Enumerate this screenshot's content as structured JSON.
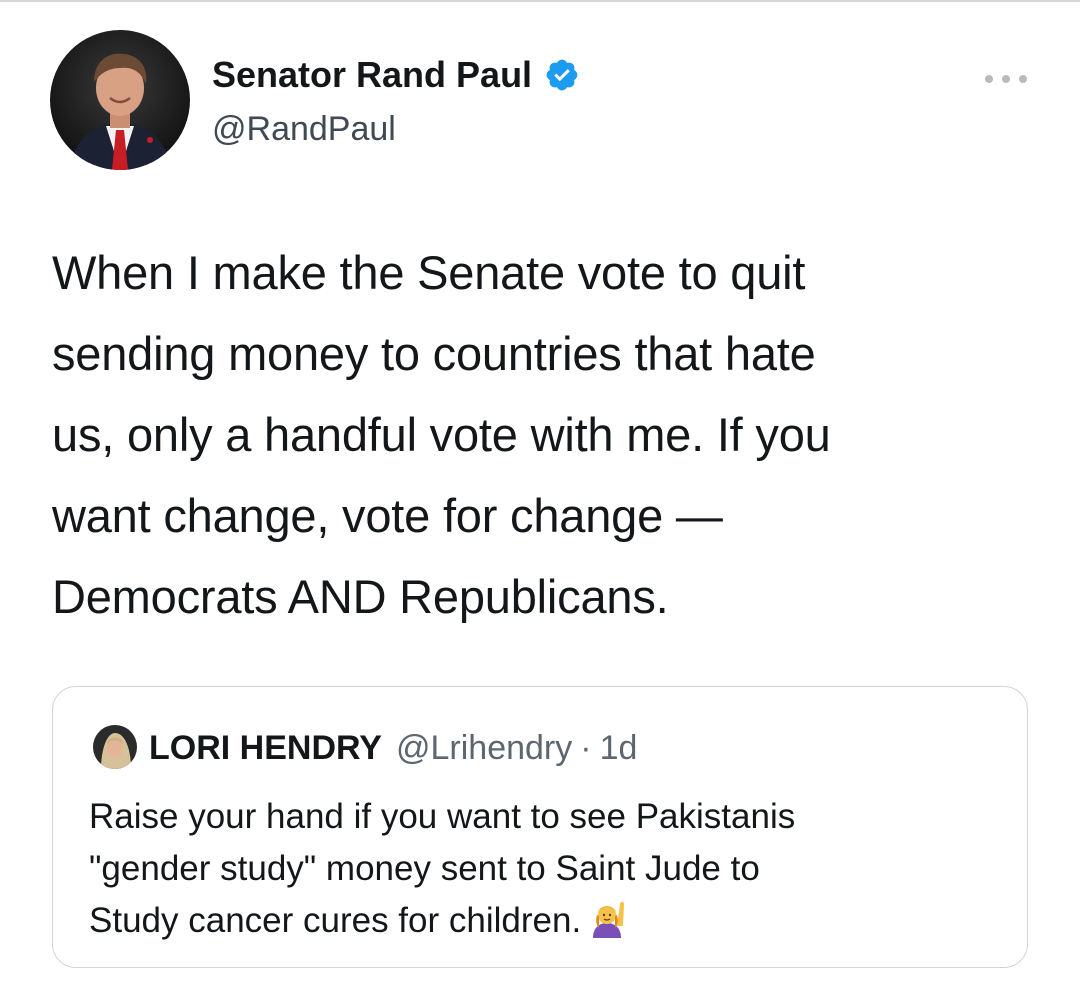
{
  "author": {
    "display_name": "Senator Rand Paul",
    "handle": "@RandPaul",
    "verified_icon": "verified-badge-icon",
    "more_icon": "more-options-icon"
  },
  "tweet": {
    "text": "When I make the Senate vote to quit\nsending money to countries that hate\nus, only a handful vote with me. If you\nwant change, vote for change —\nDemocrats AND Republicans."
  },
  "quote": {
    "display_name": "LORI HENDRY",
    "handle": "@Lrihendry",
    "separator": "·",
    "time": "1d",
    "text": "Raise your hand if you want to see Pakistanis\n\"gender study\" money sent to Saint Jude to\nStudy cancer cures for children.",
    "emoji_icon": "raising-hand-emoji-icon"
  },
  "colors": {
    "verified_blue": "#1d9bf0",
    "text_primary": "#14171a",
    "text_secondary": "#5b6670",
    "card_border": "#cfd5da"
  }
}
